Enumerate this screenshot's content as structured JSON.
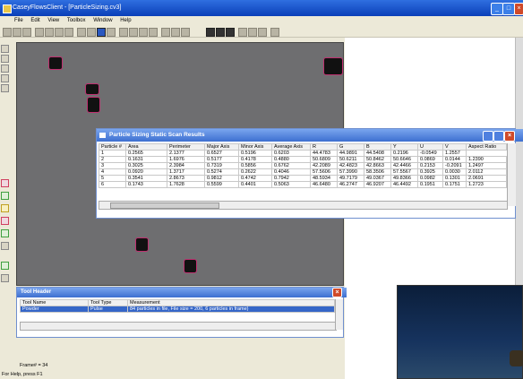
{
  "window": {
    "title": "CaseyFlowsClient - [ParticleSizing.cv3]",
    "min": "_",
    "max": "□",
    "close": "×"
  },
  "menu": [
    "File",
    "Edit",
    "View",
    "Toolbox",
    "Window",
    "Help"
  ],
  "results": {
    "title": "Particle Sizing Static Scan Results",
    "columns": [
      "Particle #",
      "Area",
      "Perimeter",
      "Major Axis",
      "Minor Axis",
      "Average Axis",
      "R",
      "G",
      "B",
      "Y",
      "U",
      "V",
      "Aspect Ratio"
    ],
    "rows": [
      [
        "1",
        "0.2565",
        "2.1377",
        "0.6527",
        "0.5196",
        "0.6203",
        "44.4783",
        "44.9891",
        "44.5408",
        "0.2196",
        "-0.0549",
        "1.2557"
      ],
      [
        "2",
        "0.1631",
        "1.6976",
        "0.5177",
        "0.4178",
        "0.4880",
        "50.6809",
        "50.6211",
        "50.8462",
        "50.6646",
        "0.0869",
        "0.0144",
        "1.2390"
      ],
      [
        "3",
        "0.3025",
        "2.3984",
        "0.7319",
        "0.5856",
        "0.6762",
        "42.2089",
        "42.4823",
        "42.8663",
        "42.4466",
        "0.2153",
        "-0.2091",
        "1.2497"
      ],
      [
        "4",
        "0.0920",
        "1.3717",
        "0.5274",
        "0.2622",
        "0.4046",
        "57.5606",
        "57.3990",
        "58.3506",
        "57.5567",
        "0.3925",
        "0.0030",
        "2.0112"
      ],
      [
        "5",
        "0.3541",
        "2.8673",
        "0.9812",
        "0.4742",
        "0.7942",
        "48.5934",
        "49.7179",
        "49.0367",
        "49.8366",
        "0.0982",
        "0.1301",
        "2.0691"
      ],
      [
        "6",
        "0.1743",
        "1.7628",
        "0.5599",
        "0.4401",
        "0.5063",
        "46.6480",
        "46.2747",
        "46.9207",
        "46.4492",
        "0.1951",
        "0.1751",
        "1.2723"
      ]
    ]
  },
  "tool_header": {
    "title": "Tool Header",
    "columns": [
      "Tool Name",
      "Tool Type",
      "Measurement"
    ],
    "row": [
      "Powder",
      "Pulse",
      "84 particles in file, File size = 200, 6 particles in frame)"
    ]
  },
  "status": {
    "frame": "Frame# = 34",
    "help": "For Help, press F1"
  }
}
